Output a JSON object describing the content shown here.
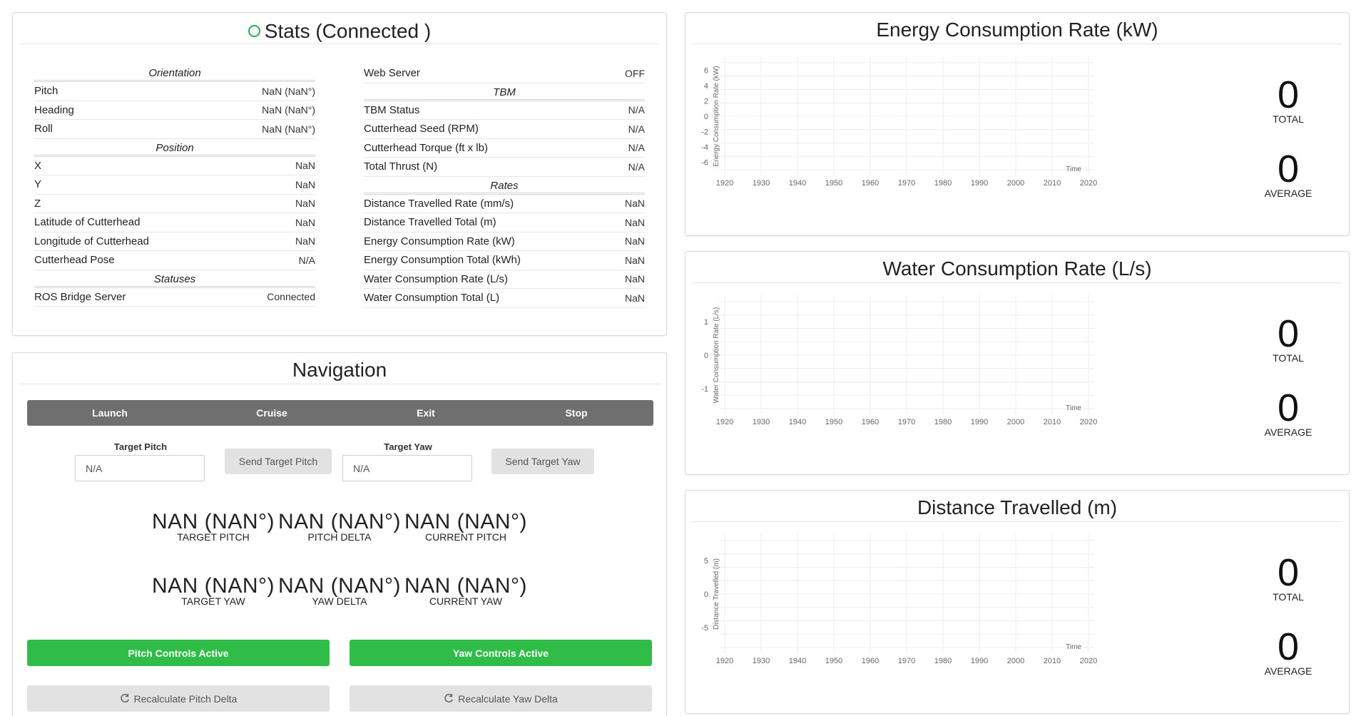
{
  "stats": {
    "title": "Stats (Connected )",
    "left": {
      "sections": [
        {
          "title": "Orientation",
          "rows": [
            {
              "label": "Pitch",
              "value": "NaN (NaN°)"
            },
            {
              "label": "Heading",
              "value": "NaN (NaN°)"
            },
            {
              "label": "Roll",
              "value": "NaN (NaN°)"
            }
          ]
        },
        {
          "title": "Position",
          "rows": [
            {
              "label": "X",
              "value": "NaN"
            },
            {
              "label": "Y",
              "value": "NaN"
            },
            {
              "label": "Z",
              "value": "NaN"
            },
            {
              "label": "Latitude of Cutterhead",
              "value": "NaN"
            },
            {
              "label": "Longitude of Cutterhead",
              "value": "NaN"
            },
            {
              "label": "Cutterhead Pose",
              "value": "N/A"
            }
          ]
        },
        {
          "title": "Statuses",
          "rows": [
            {
              "label": "ROS Bridge Server",
              "value": "Connected"
            }
          ]
        }
      ]
    },
    "right": {
      "top_row": {
        "label": "Web Server",
        "value": "OFF"
      },
      "sections": [
        {
          "title": "TBM",
          "rows": [
            {
              "label": "TBM Status",
              "value": "N/A"
            },
            {
              "label": "Cutterhead Seed (RPM)",
              "value": "N/A"
            },
            {
              "label": "Cutterhead Torque (ft x lb)",
              "value": "N/A"
            },
            {
              "label": "Total Thrust (N)",
              "value": "N/A"
            }
          ]
        },
        {
          "title": "Rates",
          "rows": [
            {
              "label": "Distance Travelled Rate (mm/s)",
              "value": "NaN"
            },
            {
              "label": "Distance Travelled Total (m)",
              "value": "NaN"
            },
            {
              "label": "Energy Consumption Rate (kW)",
              "value": "NaN"
            },
            {
              "label": "Energy Consumption Total (kWh)",
              "value": "NaN"
            },
            {
              "label": "Water Consumption Rate (L/s)",
              "value": "NaN"
            },
            {
              "label": "Water Consumption Total (L)",
              "value": "NaN"
            }
          ]
        }
      ]
    }
  },
  "navigation": {
    "title": "Navigation",
    "modes": [
      "Launch",
      "Cruise",
      "Exit",
      "Stop"
    ],
    "target_pitch_label": "Target Pitch",
    "target_pitch_value": "N/A",
    "send_pitch_label": "Send Target Pitch",
    "target_yaw_label": "Target Yaw",
    "target_yaw_value": "N/A",
    "send_yaw_label": "Send Target Yaw",
    "metrics": [
      {
        "value": "NAN (NAN°)",
        "label": "TARGET PITCH"
      },
      {
        "value": "NAN (NAN°)",
        "label": "PITCH DELTA"
      },
      {
        "value": "NAN (NAN°)",
        "label": "CURRENT PITCH"
      },
      {
        "value": "NAN (NAN°)",
        "label": "TARGET YAW"
      },
      {
        "value": "NAN (NAN°)",
        "label": "YAW DELTA"
      },
      {
        "value": "NAN (NAN°)",
        "label": "CURRENT YAW"
      }
    ],
    "pitch_controls_label": "Pitch Controls Active",
    "yaw_controls_label": "Yaw Controls Active",
    "recalc_pitch_label": "Recalculate Pitch Delta",
    "recalc_yaw_label": "Recalculate Yaw Delta",
    "accent_green": "#2fbd48",
    "mode_bar_color": "#6f6f6f"
  },
  "chart_data": [
    {
      "type": "line",
      "title": "Energy Consumption Rate (kW)",
      "ylabel": "Energy Consumption Rate (kW)",
      "xlabel": "Time",
      "x_ticks": [
        "1920",
        "1930",
        "1940",
        "1950",
        "1960",
        "1970",
        "1980",
        "1990",
        "2000",
        "2010",
        "2020"
      ],
      "y_ticks": [
        6,
        4,
        2,
        0,
        -2,
        -4,
        -6
      ],
      "ylim": [
        -7,
        7
      ],
      "series": [],
      "grid": true,
      "total_label": "TOTAL",
      "total": "0",
      "average_label": "AVERAGE",
      "average": "0"
    },
    {
      "type": "line",
      "title": "Water Consumption Rate (L/s)",
      "ylabel": "Water Consumption Rate (L/s)",
      "xlabel": "Time",
      "x_ticks": [
        "1920",
        "1930",
        "1940",
        "1950",
        "1960",
        "1970",
        "1980",
        "1990",
        "2000",
        "2010",
        "2020"
      ],
      "y_ticks": [
        1,
        0,
        -1
      ],
      "ylim": [
        -1.6,
        1.6
      ],
      "series": [],
      "grid": true,
      "total_label": "TOTAL",
      "total": "0",
      "average_label": "AVERAGE",
      "average": "0"
    },
    {
      "type": "line",
      "title": "Distance Travelled (m)",
      "ylabel": "Distance Travelled (m)",
      "xlabel": "Time",
      "x_ticks": [
        "1920",
        "1930",
        "1940",
        "1950",
        "1960",
        "1970",
        "1980",
        "1990",
        "2000",
        "2010",
        "2020"
      ],
      "y_ticks": [
        5,
        0,
        -5
      ],
      "ylim": [
        -8,
        8
      ],
      "series": [],
      "grid": true,
      "total_label": "TOTAL",
      "total": "0",
      "average_label": "AVERAGE",
      "average": "0"
    }
  ]
}
